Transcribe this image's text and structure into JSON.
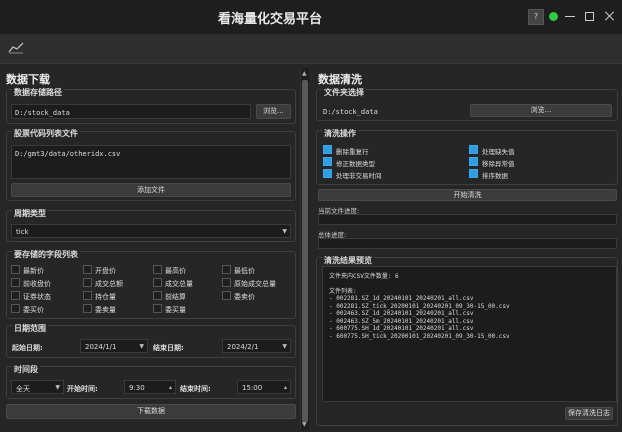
{
  "window": {
    "title": "看海量化交易平台",
    "help_label": "?"
  },
  "download": {
    "panel_title": "数据下载",
    "path_group": {
      "label": "数据存储路径",
      "value": "D:/stock_data",
      "browse_label": "浏览..."
    },
    "code_group": {
      "label": "股票代码列表文件",
      "value": "D:/gmt3/data/otheridx.csv",
      "add_label": "添加文件"
    },
    "period_group": {
      "label": "周期类型",
      "value": "tick"
    },
    "fields_group": {
      "label": "要存储的字段列表",
      "fields": [
        "最新价",
        "开盘价",
        "最高价",
        "最低价",
        "前收盘价",
        "成交总额",
        "成交总量",
        "原始成交总量",
        "证券状态",
        "持仓量",
        "前结算",
        "委卖价",
        "委买价",
        "委卖量",
        "委买量"
      ]
    },
    "date_group": {
      "label": "日期范围",
      "start_label": "起始日期:",
      "start_value": "2024/1/1",
      "end_label": "结束日期:",
      "end_value": "2024/2/1"
    },
    "time_group": {
      "label": "时间段",
      "mode_value": "全天",
      "start_label": "开始时间:",
      "start_value": "9:30",
      "end_label": "结束时间:",
      "end_value": "15:00"
    },
    "download_label": "下载数据"
  },
  "clean": {
    "panel_title": "数据清洗",
    "folder_group": {
      "label": "文件夹选择",
      "value": "D:/stock_data",
      "browse_label": "浏览..."
    },
    "ops_group": {
      "label": "清洗操作",
      "ops": [
        "删除重复行",
        "处理缺失值",
        "修正数据类型",
        "移除异常值",
        "处理非交易时间",
        "排序数据"
      ]
    },
    "start_label": "开始清洗",
    "file_progress_label": "当前文件进度:",
    "total_progress_label": "总体进度:",
    "preview_group": {
      "label": "清洗结果预览",
      "count_line": "文件夹内CSV文件数量: 6",
      "list_title": "文件列表:",
      "files": [
        "- 002281.SZ_1d_20240101_20240201_all.csv",
        "- 002281.SZ_tick_20200101_20240201_09_30-15_00.csv",
        "- 002463.SZ_1d_20240101_20240201_all.csv",
        "- 002463.SZ_5m_20240101_20240201_all.csv",
        "- 600775.SH_1d_20240101_20240201_all.csv",
        "- 600775.SH_tick_20200101_20240201_09_30-15_00.csv"
      ]
    },
    "save_log_label": "保存清洗日志"
  },
  "colors": {
    "accent": "#2f9ee0",
    "status": "#2ecc40"
  }
}
